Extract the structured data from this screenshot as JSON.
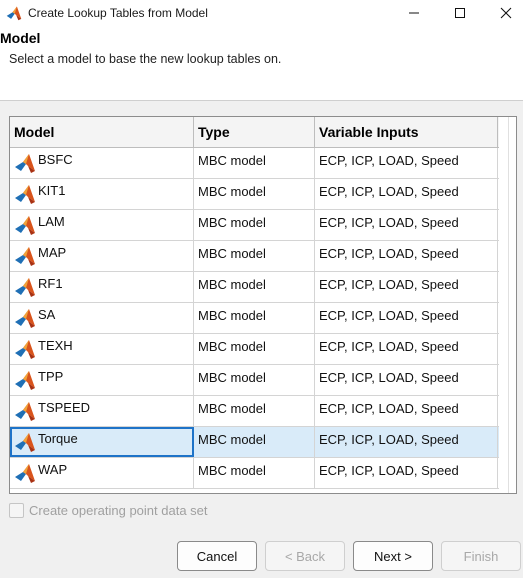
{
  "window": {
    "title": "Create Lookup Tables from Model",
    "icon": "matlab-logo-icon"
  },
  "header": {
    "title": "Model",
    "subtitle": "Select a model to base the new lookup tables on."
  },
  "table": {
    "columns": [
      "Model",
      "Type",
      "Variable Inputs"
    ],
    "rows": [
      {
        "model": "BSFC",
        "type": "MBC model",
        "inputs": "ECP, ICP, LOAD, Speed"
      },
      {
        "model": "KIT1",
        "type": "MBC model",
        "inputs": "ECP, ICP, LOAD, Speed"
      },
      {
        "model": "LAM",
        "type": "MBC model",
        "inputs": "ECP, ICP, LOAD, Speed"
      },
      {
        "model": "MAP",
        "type": "MBC model",
        "inputs": "ECP, ICP, LOAD, Speed"
      },
      {
        "model": "RF1",
        "type": "MBC model",
        "inputs": "ECP, ICP, LOAD, Speed"
      },
      {
        "model": "SA",
        "type": "MBC model",
        "inputs": "ECP, ICP, LOAD, Speed"
      },
      {
        "model": "TEXH",
        "type": "MBC model",
        "inputs": "ECP, ICP, LOAD, Speed"
      },
      {
        "model": "TPP",
        "type": "MBC model",
        "inputs": "ECP, ICP, LOAD, Speed"
      },
      {
        "model": "TSPEED",
        "type": "MBC model",
        "inputs": "ECP, ICP, LOAD, Speed"
      },
      {
        "model": "Torque",
        "type": "MBC model",
        "inputs": "ECP, ICP, LOAD, Speed"
      },
      {
        "model": "WAP",
        "type": "MBC model",
        "inputs": "ECP, ICP, LOAD, Speed"
      }
    ],
    "selected_row": "Torque"
  },
  "options": {
    "operating_point_label": "Create operating point data set",
    "operating_point_checked": false,
    "operating_point_enabled": false
  },
  "buttons": {
    "cancel": "Cancel",
    "back": "< Back",
    "next": "Next >",
    "finish": "Finish"
  },
  "colors": {
    "selection": "#d9ebf9",
    "selection_border": "#1e73c8"
  }
}
